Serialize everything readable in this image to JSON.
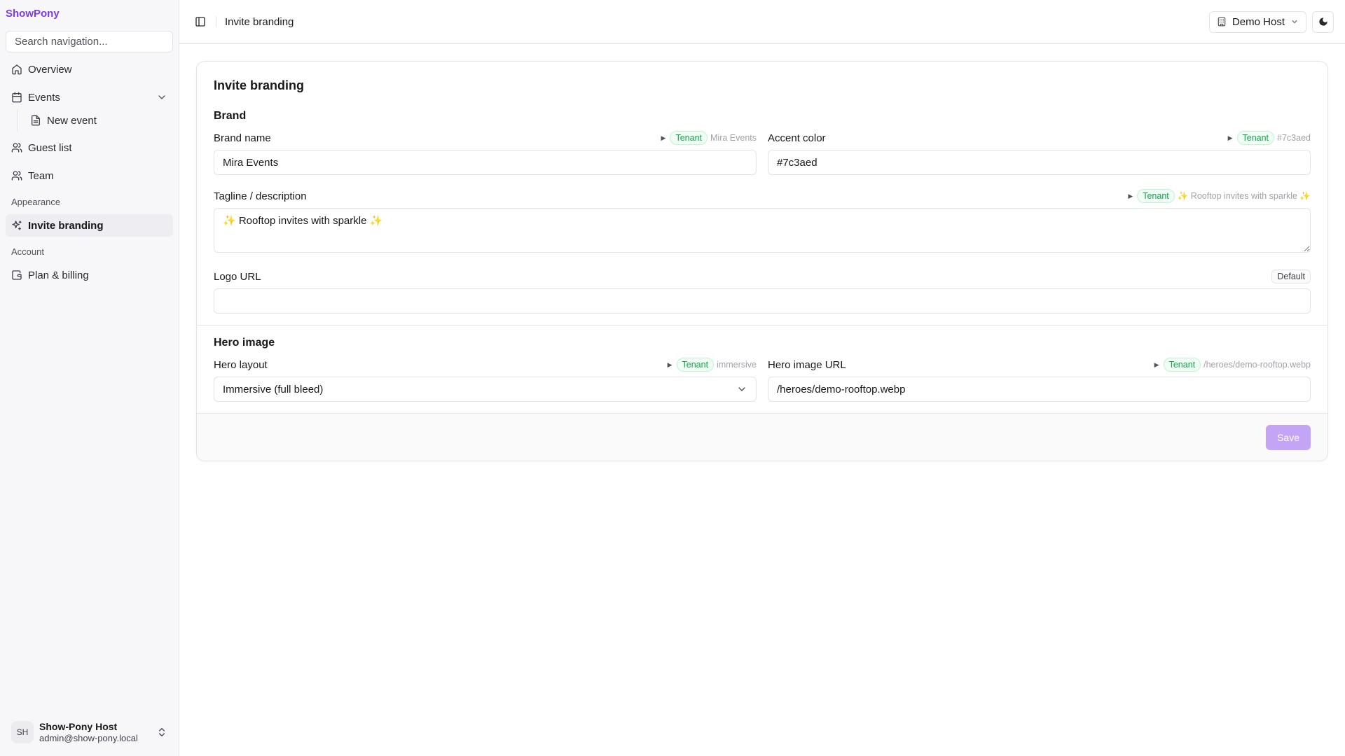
{
  "app": {
    "brand": "ShowPony"
  },
  "sidebar": {
    "search_placeholder": "Search navigation...",
    "items": {
      "overview": "Overview",
      "events": "Events",
      "new_event": "New event",
      "guest_list": "Guest list",
      "team": "Team",
      "invite_branding": "Invite branding",
      "plan_billing": "Plan & billing"
    },
    "groups": {
      "appearance": "Appearance",
      "account": "Account"
    },
    "user": {
      "initials": "SH",
      "name": "Show-Pony Host",
      "email": "admin@show-pony.local"
    }
  },
  "topbar": {
    "title": "Invite branding",
    "host_label": "Demo Host"
  },
  "card": {
    "title": "Invite branding",
    "brand_section": "Brand",
    "hero_section": "Hero image",
    "save_label": "Save",
    "source_badge": "Tenant",
    "default_badge": "Default"
  },
  "fields": {
    "brand_name": {
      "label": "Brand name",
      "value": "Mira Events",
      "inherited": "Mira Events"
    },
    "accent_color": {
      "label": "Accent color",
      "value": "#7c3aed",
      "inherited": "#7c3aed"
    },
    "tagline": {
      "label": "Tagline / description",
      "value": "✨ Rooftop invites with sparkle ✨",
      "inherited": "✨ Rooftop invites with sparkle ✨"
    },
    "logo_url": {
      "label": "Logo URL",
      "value": ""
    },
    "hero_layout": {
      "label": "Hero layout",
      "value": "Immersive (full bleed)",
      "inherited": "immersive"
    },
    "hero_image_url": {
      "label": "Hero image URL",
      "value": "/heroes/demo-rooftop.webp",
      "inherited": "/heroes/demo-rooftop.webp"
    }
  },
  "colors": {
    "accent": "#7c3aed",
    "tenant_green": "#16a34a",
    "save_disabled": "#c4a5f5"
  }
}
